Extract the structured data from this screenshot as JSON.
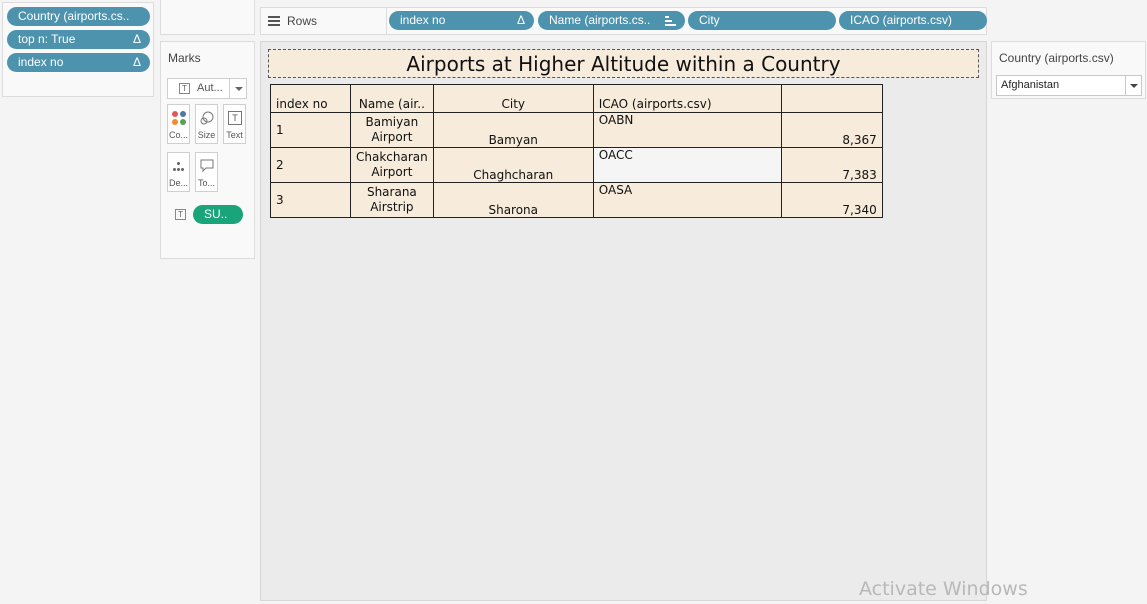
{
  "filters": {
    "pills": [
      {
        "label": "Country (airports.cs..",
        "delta": ""
      },
      {
        "label": "top n: True",
        "delta": "Δ"
      },
      {
        "label": "index no",
        "delta": "Δ"
      }
    ]
  },
  "rows_shelf": {
    "label": "Rows",
    "pills": [
      {
        "label": "index no",
        "delta": "Δ"
      },
      {
        "label": "Name (airports.cs..",
        "sorted": true
      },
      {
        "label": "City"
      },
      {
        "label": "ICAO (airports.csv)"
      }
    ]
  },
  "marks": {
    "title": "Marks",
    "mark_type": "Aut...",
    "buttons": {
      "color": "Co...",
      "size": "Size",
      "text": "Text",
      "detail": "De...",
      "tooltip": "To..."
    },
    "sum_pill": "SU..",
    "text_glyph": "T"
  },
  "viz": {
    "title": "Airports at Higher Altitude within a Country",
    "columns": [
      "index no",
      "Name (air..",
      "City",
      "ICAO (airports.csv)",
      ""
    ],
    "rows": [
      {
        "index": "1",
        "name_line1": "Bamiyan",
        "name_line2": "Airport",
        "city": "Bamyan",
        "icao": "OABN",
        "altitude": "8,367"
      },
      {
        "index": "2",
        "name_line1": "Chakcharan",
        "name_line2": "Airport",
        "city": "Chaghcharan",
        "icao": "OACC",
        "altitude": "7,383"
      },
      {
        "index": "3",
        "name_line1": "Sharana",
        "name_line2": "Airstrip",
        "city": "Sharona",
        "icao": "OASA",
        "altitude": "7,340"
      }
    ]
  },
  "filter_card": {
    "title": "Country (airports.csv)",
    "selected": "Afghanistan"
  },
  "watermark": "Activate Windows",
  "colors": {
    "pill_blue": "#4e93ae",
    "pill_green": "#1aa47a",
    "table_bg": "#f7ebdb",
    "viz_bg": "#ebebeb"
  }
}
